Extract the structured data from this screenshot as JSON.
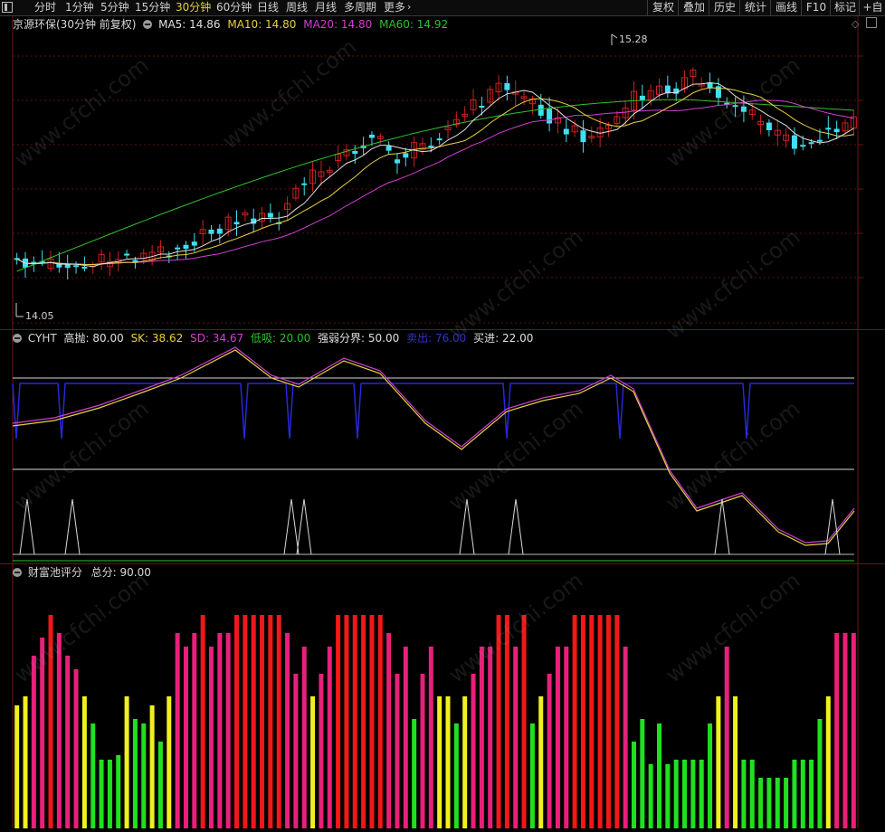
{
  "toolbar": {
    "periods": [
      "分时",
      "1分钟",
      "5分钟",
      "15分钟",
      "30分钟",
      "60分钟",
      "日线",
      "周线",
      "月线",
      "多周期",
      "更多"
    ],
    "active_period": "30分钟",
    "right_buttons": [
      "复权",
      "叠加",
      "历史",
      "统计",
      "画线",
      "F10",
      "标记",
      "+自选"
    ]
  },
  "main": {
    "title": "京源环保(30分钟 前复权)",
    "ma": [
      {
        "label": "MA5: 14.86",
        "color": "#e0e0e0"
      },
      {
        "label": "MA10: 14.80",
        "color": "#e8d040"
      },
      {
        "label": "MA20: 14.80",
        "color": "#d040d0"
      },
      {
        "label": "MA60: 14.92",
        "color": "#30c030"
      }
    ],
    "high_label": "15.28",
    "low_label": "14.05"
  },
  "cyht": {
    "name": "CYHT",
    "params": [
      {
        "label": "高抛: 80.00",
        "color": "#e0e0e0"
      },
      {
        "label": "SK: 38.62",
        "color": "#e8d040"
      },
      {
        "label": "SD: 34.67",
        "color": "#d040d0"
      },
      {
        "label": "低吸: 20.00",
        "color": "#30c030"
      },
      {
        "label": "强弱分界: 50.00",
        "color": "#e0e0e0"
      },
      {
        "label": "卖出: 76.00",
        "color": "#3030d0"
      },
      {
        "label": "买进: 22.00",
        "color": "#e0e0e0"
      }
    ]
  },
  "score": {
    "name": "财富池评分",
    "total_label": "总分: 90.00"
  },
  "watermark": "www.cfchi.com",
  "colors": {
    "up": "#d02020",
    "down": "#40e0f0",
    "ma5": "#e0e0e0",
    "ma10": "#e8d040",
    "ma20": "#d040d0",
    "ma60": "#30c030"
  }
}
